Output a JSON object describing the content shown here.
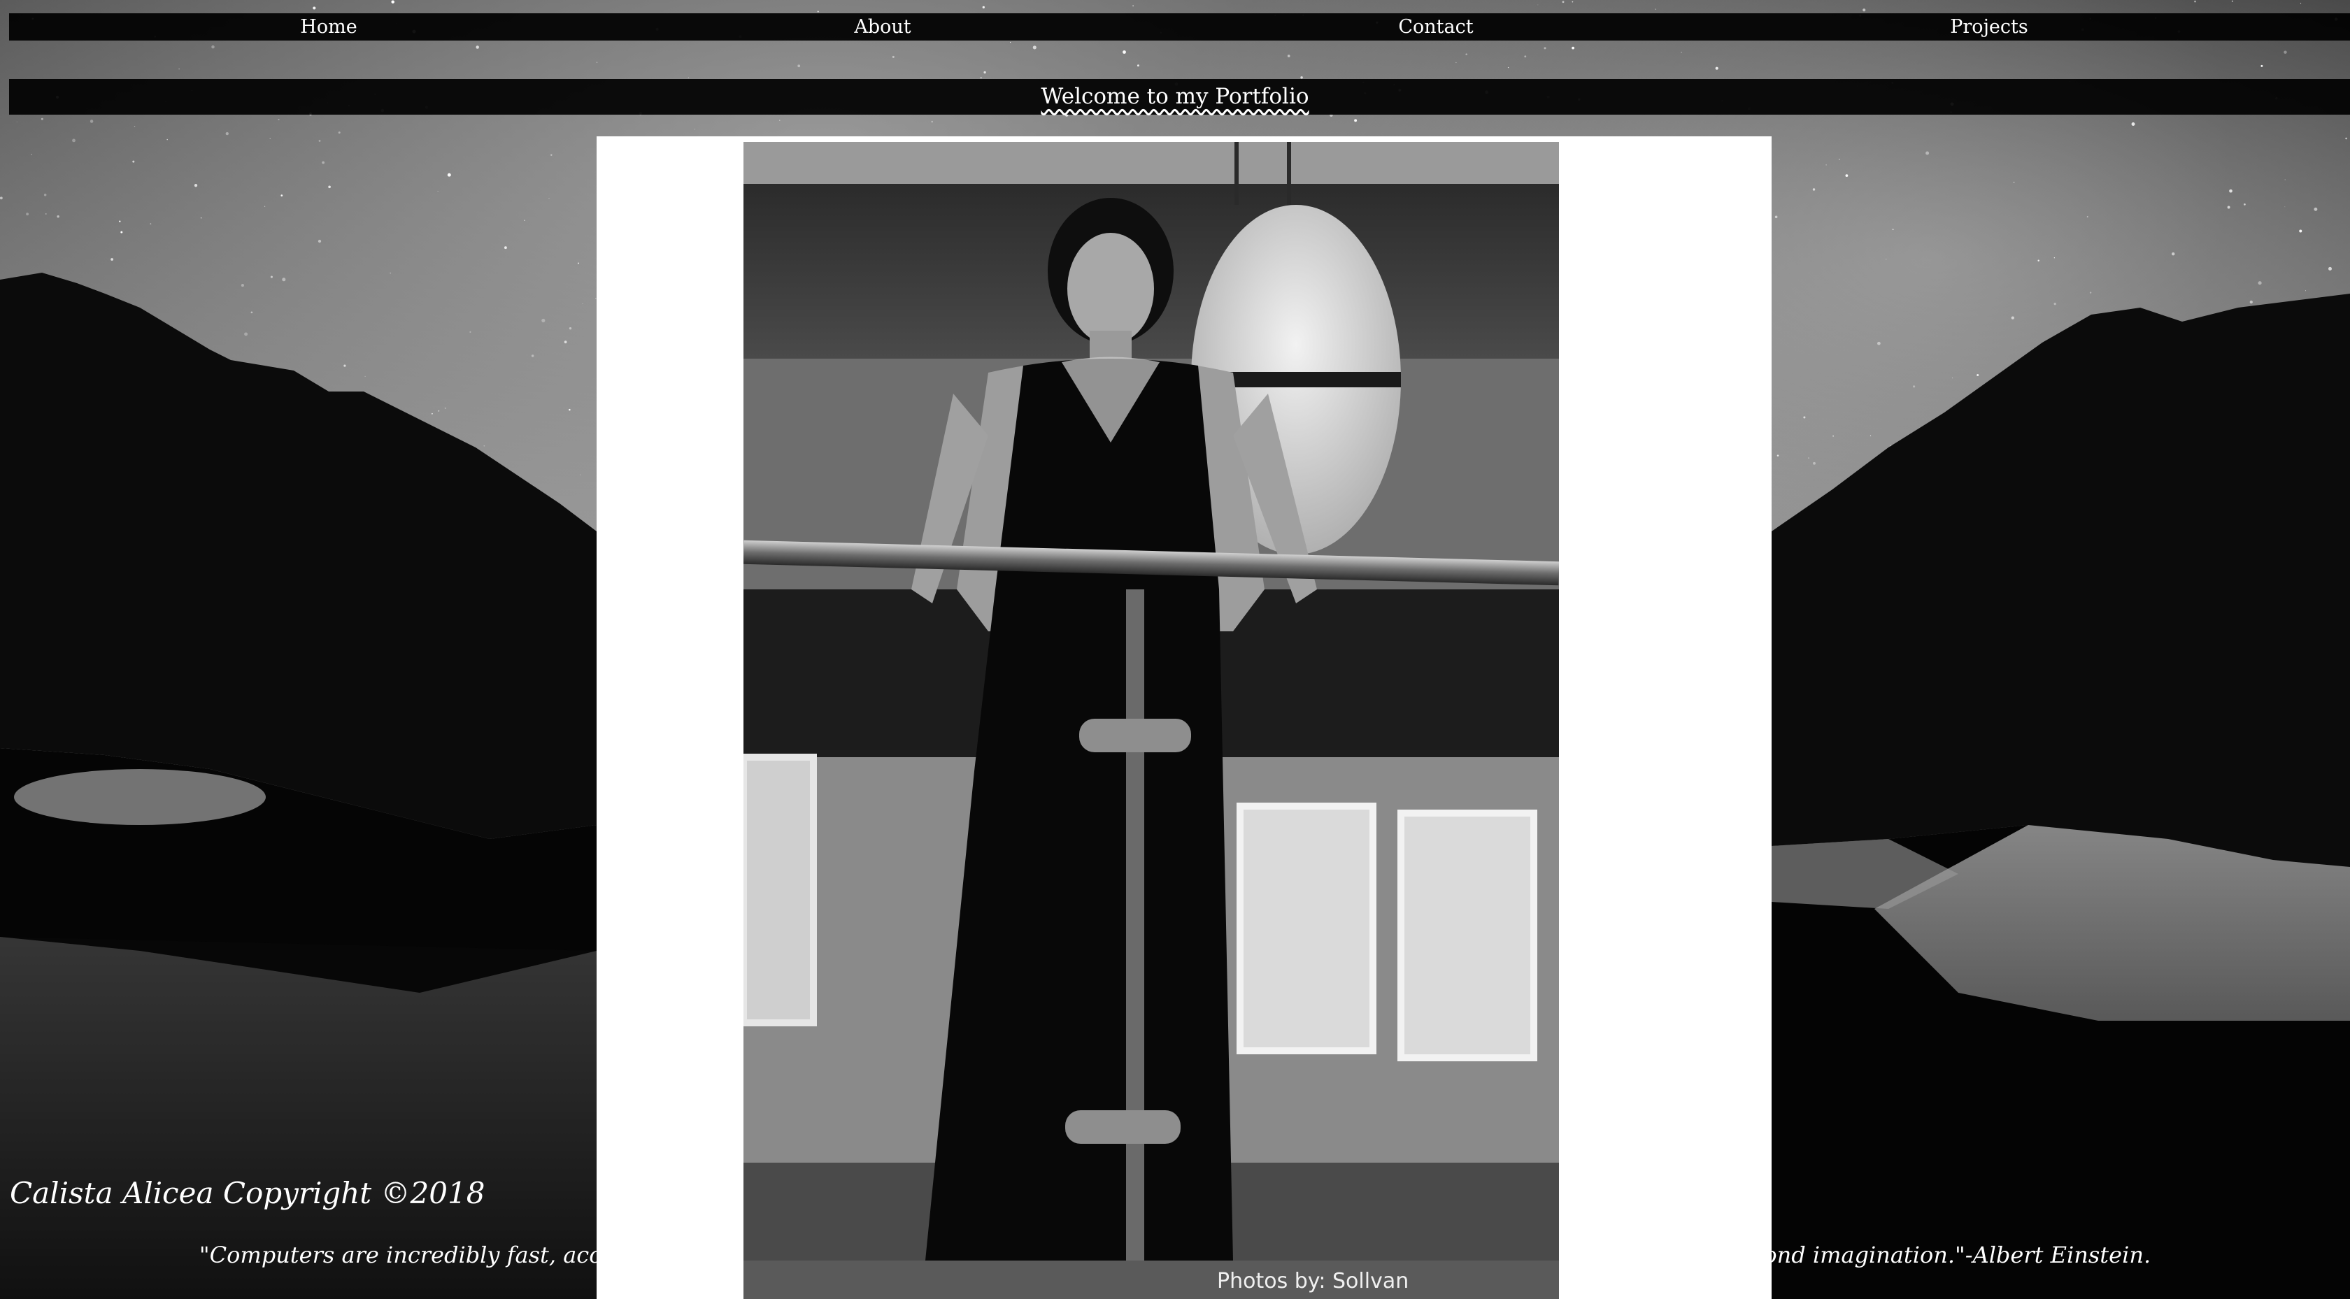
{
  "nav": {
    "items": [
      {
        "label": "Home"
      },
      {
        "label": "About"
      },
      {
        "label": "Contact"
      },
      {
        "label": "Projects"
      }
    ]
  },
  "header": {
    "title": "Welcome to my Portfolio"
  },
  "photo": {
    "credit": "Photos by: Sollvan Photography"
  },
  "footer": {
    "copyright": "Calista Alicea Copyright ©2018",
    "quote": "\"Computers are incredibly fast, accurate and stupid; humans are incredibly slow, inaccurate and brilliant, together they are powerful beyond imagination.\"-Albert Einstein."
  },
  "colors": {
    "bars": "#000000",
    "text": "#ffffff",
    "panel": "#ffffff"
  }
}
